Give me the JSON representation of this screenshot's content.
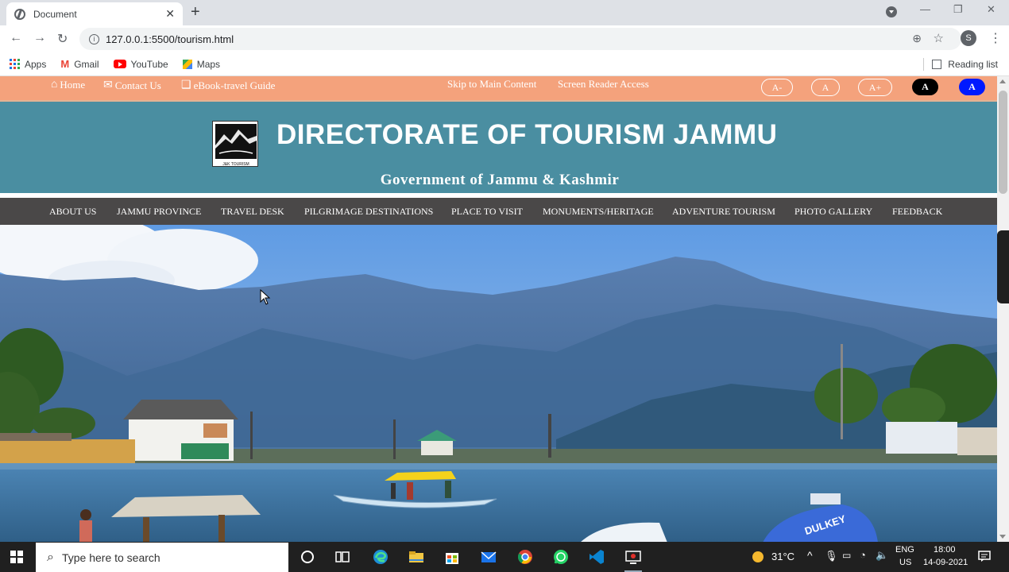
{
  "browser": {
    "tab_title": "Document",
    "tab_close": "✕",
    "new_tab": "+",
    "url": "127.0.0.1:5500/tourism.html",
    "avatar_letter": "S",
    "bookmarks": [
      {
        "label": "Apps",
        "icon": "apps-icon"
      },
      {
        "label": "Gmail",
        "icon": "gmail-icon"
      },
      {
        "label": "YouTube",
        "icon": "youtube-icon"
      },
      {
        "label": "Maps",
        "icon": "maps-icon"
      }
    ],
    "reading_list": "Reading list"
  },
  "site": {
    "top_links": {
      "home": "Home",
      "contact": "Contact Us",
      "ebook": "eBook-travel Guide",
      "skip": "Skip to Main Content",
      "screen_reader": "Screen Reader Access"
    },
    "font_buttons": {
      "decrease": "A-",
      "normal": "A",
      "increase": "A+"
    },
    "contrast_buttons": {
      "dark": "A",
      "blue": "A"
    },
    "title": "DIRECTORATE OF TOURISM JAMMU",
    "subtitle": "Government of Jammu & Kashmir",
    "logo_text": "J&K TOURISM",
    "nav": [
      "ABOUT US",
      "JAMMU PROVINCE",
      "TRAVEL DESK",
      "PILGRIMAGE DESTINATIONS",
      "PLACE TO VISIT",
      "MONUMENTS/HERITAGE",
      "ADVENTURE TOURISM",
      "PHOTO GALLERY",
      "FEEDBACK"
    ],
    "hero_boat_label": "DULKEY"
  },
  "taskbar": {
    "search_placeholder": "Type here to search",
    "weather": "31°C",
    "lang_top": "ENG",
    "lang_bottom": "US",
    "time": "18:00",
    "date": "14-09-2021"
  },
  "colors": {
    "top_strip": "#f4a27c",
    "header": "#4a8ea1",
    "nav": "#4a4848",
    "contrast_blue": "#0019ff"
  }
}
